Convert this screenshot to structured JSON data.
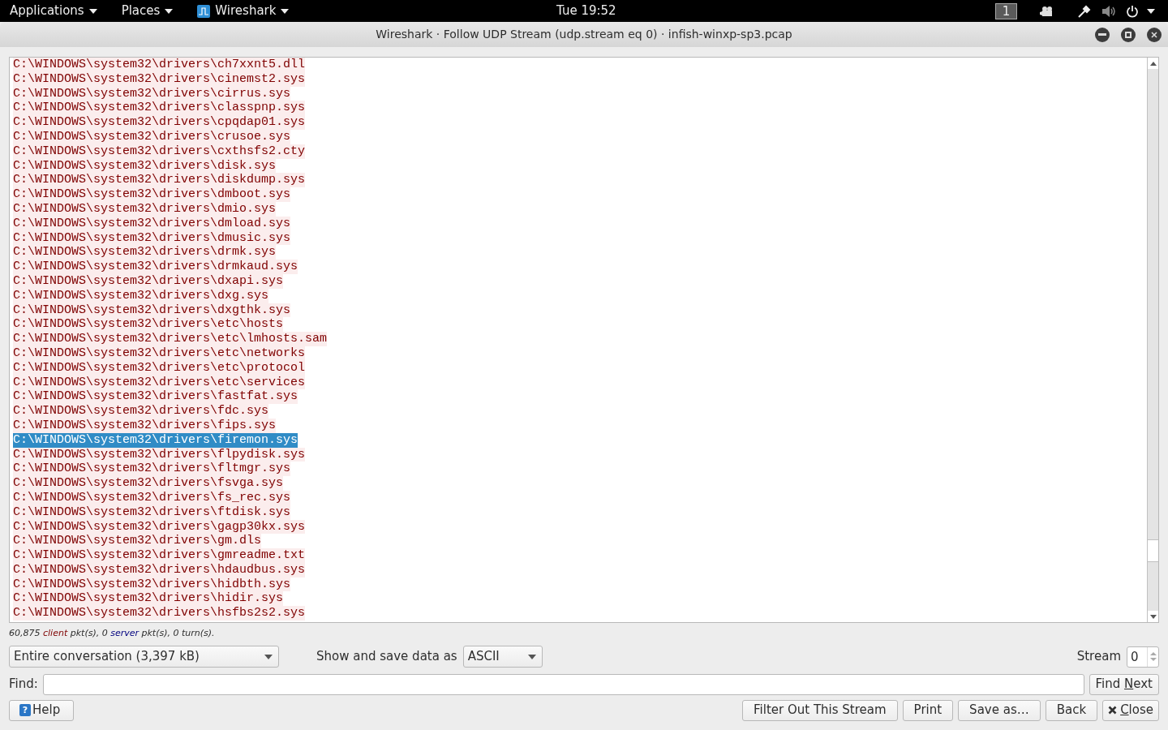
{
  "top_bar": {
    "menus": [
      {
        "label": "Applications",
        "kind": "text"
      },
      {
        "label": "Places",
        "kind": "text"
      },
      {
        "label": "Wireshark",
        "kind": "app"
      }
    ],
    "clock": "Tue 19:52",
    "workspace": "1"
  },
  "window": {
    "title": "Wireshark · Follow UDP Stream (udp.stream eq 0) · infish-winxp-sp3.pcap"
  },
  "stream_lines": [
    {
      "text": "C:\\WINDOWS\\system32\\drivers\\ch7xxnt5.dll",
      "selected": false
    },
    {
      "text": "C:\\WINDOWS\\system32\\drivers\\cinemst2.sys",
      "selected": false
    },
    {
      "text": "C:\\WINDOWS\\system32\\drivers\\cirrus.sys",
      "selected": false
    },
    {
      "text": "C:\\WINDOWS\\system32\\drivers\\classpnp.sys",
      "selected": false
    },
    {
      "text": "C:\\WINDOWS\\system32\\drivers\\cpqdap01.sys",
      "selected": false
    },
    {
      "text": "C:\\WINDOWS\\system32\\drivers\\crusoe.sys",
      "selected": false
    },
    {
      "text": "C:\\WINDOWS\\system32\\drivers\\cxthsfs2.cty",
      "selected": false
    },
    {
      "text": "C:\\WINDOWS\\system32\\drivers\\disk.sys",
      "selected": false
    },
    {
      "text": "C:\\WINDOWS\\system32\\drivers\\diskdump.sys",
      "selected": false
    },
    {
      "text": "C:\\WINDOWS\\system32\\drivers\\dmboot.sys",
      "selected": false
    },
    {
      "text": "C:\\WINDOWS\\system32\\drivers\\dmio.sys",
      "selected": false
    },
    {
      "text": "C:\\WINDOWS\\system32\\drivers\\dmload.sys",
      "selected": false
    },
    {
      "text": "C:\\WINDOWS\\system32\\drivers\\dmusic.sys",
      "selected": false
    },
    {
      "text": "C:\\WINDOWS\\system32\\drivers\\drmk.sys",
      "selected": false
    },
    {
      "text": "C:\\WINDOWS\\system32\\drivers\\drmkaud.sys",
      "selected": false
    },
    {
      "text": "C:\\WINDOWS\\system32\\drivers\\dxapi.sys",
      "selected": false
    },
    {
      "text": "C:\\WINDOWS\\system32\\drivers\\dxg.sys",
      "selected": false
    },
    {
      "text": "C:\\WINDOWS\\system32\\drivers\\dxgthk.sys",
      "selected": false
    },
    {
      "text": "C:\\WINDOWS\\system32\\drivers\\etc\\hosts",
      "selected": false
    },
    {
      "text": "C:\\WINDOWS\\system32\\drivers\\etc\\lmhosts.sam",
      "selected": false
    },
    {
      "text": "C:\\WINDOWS\\system32\\drivers\\etc\\networks",
      "selected": false
    },
    {
      "text": "C:\\WINDOWS\\system32\\drivers\\etc\\protocol",
      "selected": false
    },
    {
      "text": "C:\\WINDOWS\\system32\\drivers\\etc\\services",
      "selected": false
    },
    {
      "text": "C:\\WINDOWS\\system32\\drivers\\fastfat.sys",
      "selected": false
    },
    {
      "text": "C:\\WINDOWS\\system32\\drivers\\fdc.sys",
      "selected": false
    },
    {
      "text": "C:\\WINDOWS\\system32\\drivers\\fips.sys",
      "selected": false
    },
    {
      "text": "C:\\WINDOWS\\system32\\drivers\\firemon.sys",
      "selected": true
    },
    {
      "text": "C:\\WINDOWS\\system32\\drivers\\flpydisk.sys",
      "selected": false
    },
    {
      "text": "C:\\WINDOWS\\system32\\drivers\\fltmgr.sys",
      "selected": false
    },
    {
      "text": "C:\\WINDOWS\\system32\\drivers\\fsvga.sys",
      "selected": false
    },
    {
      "text": "C:\\WINDOWS\\system32\\drivers\\fs_rec.sys",
      "selected": false
    },
    {
      "text": "C:\\WINDOWS\\system32\\drivers\\ftdisk.sys",
      "selected": false
    },
    {
      "text": "C:\\WINDOWS\\system32\\drivers\\gagp30kx.sys",
      "selected": false
    },
    {
      "text": "C:\\WINDOWS\\system32\\drivers\\gm.dls",
      "selected": false
    },
    {
      "text": "C:\\WINDOWS\\system32\\drivers\\gmreadme.txt",
      "selected": false
    },
    {
      "text": "C:\\WINDOWS\\system32\\drivers\\hdaudbus.sys",
      "selected": false
    },
    {
      "text": "C:\\WINDOWS\\system32\\drivers\\hidbth.sys",
      "selected": false
    },
    {
      "text": "C:\\WINDOWS\\system32\\drivers\\hidir.sys",
      "selected": false
    },
    {
      "text": "C:\\WINDOWS\\system32\\drivers\\hsfbs2s2.sys",
      "selected": false
    }
  ],
  "summary": [
    {
      "text": "60,875 ",
      "kind": "plain"
    },
    {
      "text": "client",
      "kind": "client"
    },
    {
      "text": " pkt(s), 0 ",
      "kind": "plain"
    },
    {
      "text": "server",
      "kind": "server"
    },
    {
      "text": " pkt(s), 0 turn(s).",
      "kind": "plain"
    }
  ],
  "conversation_select": {
    "value": "Entire conversation (3,397 kB)"
  },
  "format": {
    "label": "Show and save data as",
    "value": "ASCII"
  },
  "stream": {
    "label": "Stream",
    "value": "0"
  },
  "find": {
    "label": "Find:",
    "button": {
      "before": "Find ",
      "key": "N",
      "after": "ext"
    }
  },
  "help_button": {
    "icon_text": "?",
    "label": "Help"
  },
  "buttons": [
    {
      "label": "Filter Out This Stream",
      "kind": "plain"
    },
    {
      "label": "Print",
      "kind": "plain"
    },
    {
      "label": "Save as…",
      "kind": "plain"
    },
    {
      "label": "Back",
      "kind": "plain"
    },
    {
      "key": "C",
      "after": "lose",
      "kind": "close"
    }
  ]
}
